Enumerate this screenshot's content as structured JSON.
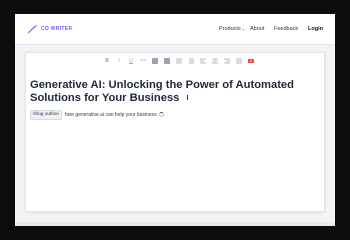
{
  "header": {
    "logo_text": "CO WRITER",
    "nav": {
      "products": "Products",
      "about": "About",
      "feedback": "Feedback",
      "login": "Login"
    }
  },
  "editor": {
    "toolbar_icons": [
      "bold-icon",
      "italic-icon",
      "underline-icon",
      "code-icon",
      "heading-1-icon",
      "heading-2-icon",
      "bullet-list-icon",
      "numbered-list-icon",
      "align-left-icon",
      "align-center-icon",
      "align-right-icon",
      "align-justify-icon",
      "youtube-icon"
    ],
    "title": "Generative AI: Unlocking the Power of Automated Solutions for Your Business",
    "command_chip": "/blog outline",
    "prompt_text": "how generative ai can help your business"
  },
  "colors": {
    "brand": "#7a5af8",
    "accent_red": "#ef4444"
  }
}
